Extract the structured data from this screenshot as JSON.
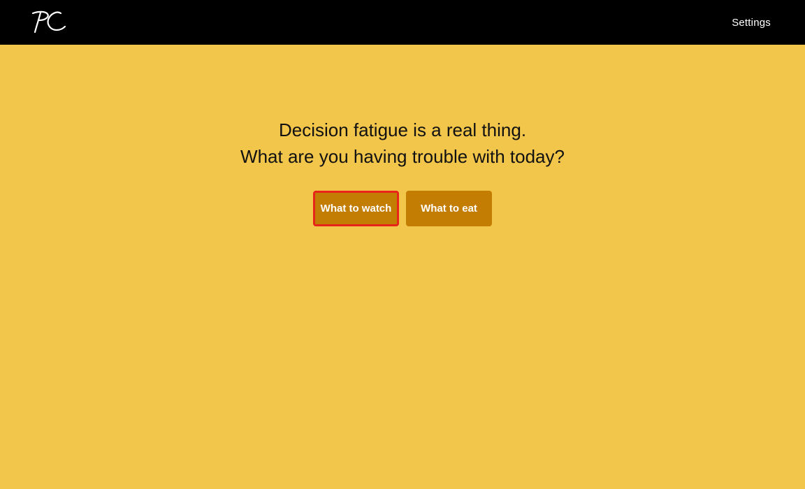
{
  "header": {
    "logo_text": "PC",
    "settings_label": "Settings"
  },
  "hero": {
    "line1": "Decision fatigue is a real thing.",
    "line2": "What are you having trouble with today?"
  },
  "actions": {
    "watch_label": "What to watch",
    "eat_label": "What to eat"
  },
  "colors": {
    "background": "#f2c64b",
    "header": "#000000",
    "button": "#c47d03",
    "focus_outline": "#e8231a"
  }
}
